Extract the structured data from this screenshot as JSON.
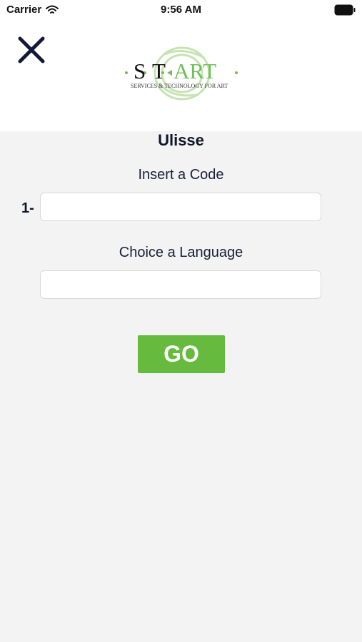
{
  "status_bar": {
    "carrier": "Carrier",
    "time": "9:56 AM"
  },
  "header": {
    "close_icon": "close-icon",
    "logo": {
      "text": "S·T·ART",
      "tagline": "SERVICES & TECHNOLOGY FOR ART"
    }
  },
  "main": {
    "title": "Ulisse",
    "code_label": "Insert a Code",
    "row_prefix": "1-",
    "code_value": "",
    "code_placeholder": "",
    "language_label": "Choice a Language",
    "language_value": "",
    "language_placeholder": "",
    "go_label": "GO"
  },
  "colors": {
    "background": "#f2f3f2",
    "header_background": "#ffffff",
    "go_button": "#66bb3f",
    "text_dark": "#10152b",
    "logo_green": "#6fbf53"
  }
}
